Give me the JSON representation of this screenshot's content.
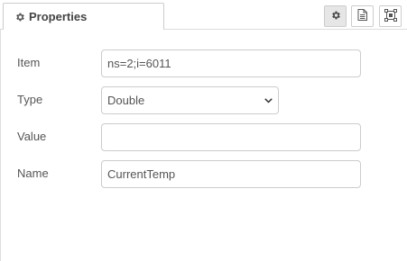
{
  "tabs": [
    {
      "label": "Properties",
      "icon": "gear-icon"
    }
  ],
  "toolbar": {
    "properties_icon": "gear-icon",
    "description_icon": "document-icon",
    "appearance_icon": "appearance-icon"
  },
  "form": {
    "item": {
      "label": "Item",
      "value": "ns=2;i=6011"
    },
    "type": {
      "label": "Type",
      "value": "Double"
    },
    "value": {
      "label": "Value",
      "value": ""
    },
    "name": {
      "label": "Name",
      "value": "CurrentTemp"
    }
  },
  "colors": {
    "border": "#cccccc",
    "text": "#555555",
    "active_button": "#e6e6e6"
  }
}
